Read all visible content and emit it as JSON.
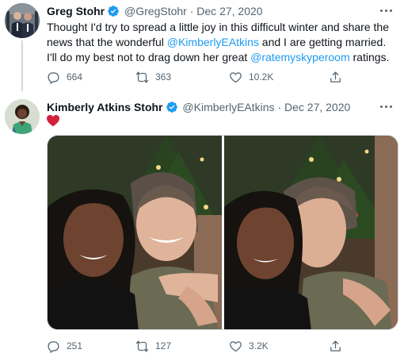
{
  "tweets": [
    {
      "author_name": "Greg Stohr",
      "handle": "@GregStohr",
      "separator": "·",
      "date": "Dec 27, 2020",
      "text_1": "Thought I'd try to spread a little joy in this difficult winter and share the news that the wonderful ",
      "mention_1": "@KimberlyEAtkins",
      "text_2": " and I are getting married. I'll do my best not to drag down her great ",
      "mention_2": "@ratemyskyperoom",
      "text_3": " ratings.",
      "replies": "664",
      "retweets": "363",
      "likes": "10.2K"
    },
    {
      "author_name": "Kimberly Atkins Stohr",
      "handle": "@KimberlyEAtkins",
      "separator": "·",
      "date": "Dec 27, 2020",
      "body_emoji": "red-heart",
      "replies": "251",
      "retweets": "127",
      "likes": "3.2K"
    }
  ],
  "icons": {
    "verified": "verified-badge-icon",
    "more": "more-dots-icon",
    "reply": "reply-icon",
    "retweet": "retweet-icon",
    "like": "heart-outline-icon",
    "share": "share-icon",
    "heart_emoji": "red-heart-icon"
  },
  "colors": {
    "accent": "#1d9bf0",
    "text_primary": "#0f1419",
    "text_secondary": "#536471",
    "heart": "#d4213a"
  }
}
